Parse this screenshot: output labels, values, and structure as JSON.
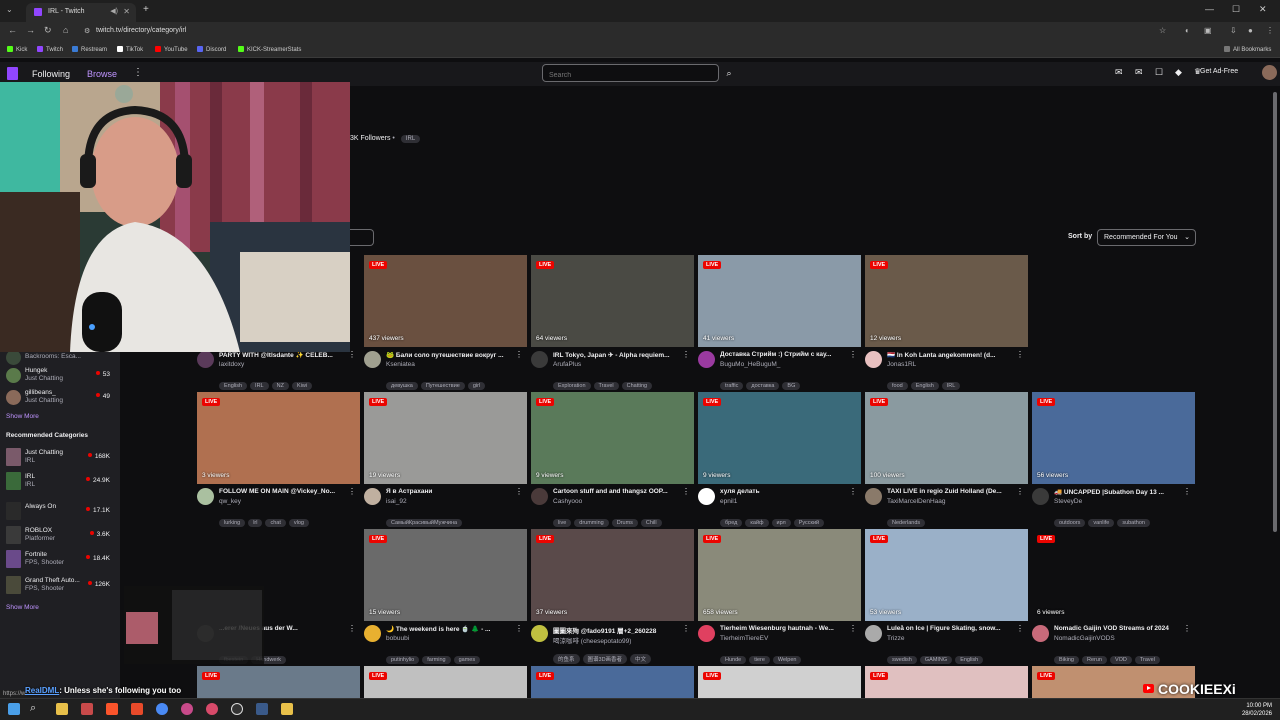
{
  "browser": {
    "tab_title": "IRL - Twitch",
    "url": "twitch.tv/directory/category/irl",
    "bookmarks": [
      "Kick",
      "Twitch",
      "Restream",
      "TikTok",
      "YouTube",
      "Discord",
      "KICK-StreamerStats"
    ],
    "all_bookmarks": "All Bookmarks",
    "status_url": "https://w..."
  },
  "topnav": {
    "following": "Following",
    "browse": "Browse",
    "search_placeholder": "Search",
    "ad_free": "Get Ad-Free"
  },
  "category": {
    "followers": "3K Followers",
    "tag": "IRL"
  },
  "sort": {
    "label": "Sort by",
    "value": "Recommended For You"
  },
  "sidebar": {
    "following": [
      {
        "name": "Backrooms: Esca...",
        "category": "",
        "viewers": ""
      },
      {
        "name": "Hungek",
        "category": "Just Chatting",
        "viewers": "53"
      },
      {
        "name": "gillibeans_",
        "category": "Just Chatting",
        "viewers": "49"
      }
    ],
    "show_more_1": "Show More",
    "recommended_heading": "Recommended Categories",
    "categories": [
      {
        "name": "Just Chatting",
        "sub": "IRL",
        "viewers": "168K"
      },
      {
        "name": "IRL",
        "sub": "IRL",
        "viewers": "24.9K"
      },
      {
        "name": "Always On",
        "sub": "",
        "viewers": "17.1K"
      },
      {
        "name": "ROBLOX",
        "sub": "Platformer",
        "viewers": "3.6K"
      },
      {
        "name": "Fortnite",
        "sub": "FPS, Shooter",
        "viewers": "18.4K"
      },
      {
        "name": "Grand Theft Auto...",
        "sub": "FPS, Shooter",
        "viewers": "126K"
      }
    ],
    "show_more_2": "Show More"
  },
  "streams": [
    {
      "title": "PARTY WITH @ltlsdante ✨ CELEB...",
      "channel": "laxitdoxy",
      "viewers": "",
      "tags": [
        "English",
        "IRL",
        "NZ",
        "Kiwi"
      ]
    },
    {
      "title": "🐸 Бали соло путешествие вокруг ...",
      "channel": "Kseniatea",
      "viewers": "437 viewers",
      "tags": [
        "девушка",
        "Путешествие",
        "girl"
      ]
    },
    {
      "title": "IRL Tokyo, Japan ✈ - Alpha requiem...",
      "channel": "ArufaPlus",
      "viewers": "64 viewers",
      "tags": [
        "Exploration",
        "Travel",
        "Chatting"
      ]
    },
    {
      "title": "Доставка Стрийм :) Стрийм с кау...",
      "channel": "BuguMo_HeBuguM_",
      "viewers": "41 viewers",
      "tags": [
        "traffic",
        "доставка",
        "BG"
      ]
    },
    {
      "title": "🇳🇱 In Koh Lanta angekommen! (d...",
      "channel": "Jonas1RL",
      "viewers": "12 viewers",
      "tags": [
        "food",
        "English",
        "IRL"
      ]
    },
    {
      "title": "FOLLOW ME ON MAIN @Vickey_No...",
      "channel": "qw_key",
      "viewers": "3 viewers",
      "tags": [
        "lurking",
        "lrl",
        "chat",
        "vlog"
      ]
    },
    {
      "title": "Я в Астрахани",
      "channel": "isai_92",
      "viewers": "19 viewers",
      "tags": [
        "СамыйКрасивыйМужчина"
      ]
    },
    {
      "title": "Cartoon stuff and and thangsz OOP...",
      "channel": "Cashyooo",
      "viewers": "9 viewers",
      "tags": [
        "live",
        "drumming",
        "Drums",
        "Chill"
      ]
    },
    {
      "title": "хуля делать",
      "channel": "epnil1",
      "viewers": "9 viewers",
      "tags": [
        "бред",
        "кайф",
        "ирл",
        "Русский"
      ]
    },
    {
      "title": "TAXI LIVE in regio Zuid Holland (De...",
      "channel": "TaxiMarcelDenHaag",
      "viewers": "100 viewers",
      "tags": [
        "Nederlands"
      ]
    },
    {
      "title": "🚚 UNCAPPED |Subathon Day 13 ...",
      "channel": "SteveyDe",
      "viewers": "56 viewers",
      "tags": [
        "outdoors",
        "vanlife",
        "subathon"
      ]
    },
    {
      "title": "...erer /Neues aus der W...",
      "channel": "",
      "viewers": "",
      "tags": [
        "fbestein",
        "Handwerk"
      ]
    },
    {
      "title": "🌙 The weekend is here 🍵 🌲 - ...",
      "channel": "bobuubi",
      "viewers": "15 viewers",
      "tags": [
        "putinhylio",
        "farming",
        "games"
      ]
    },
    {
      "title": "圖圖來殉 @fado9191 層+2_260228",
      "channel": "喝涼咖啡 (cheesepotato99)",
      "viewers": "37 viewers",
      "tags": [
        "的鱼系",
        "圖谱3D画香者",
        "中文"
      ]
    },
    {
      "title": "Tierheim Wiesenburg hautnah - We...",
      "channel": "TierheimTiereEV",
      "viewers": "658 viewers",
      "tags": [
        "Hunde",
        "tiere",
        "Welpen"
      ]
    },
    {
      "title": "Luleå on Ice | Figure Skating, snow...",
      "channel": "Trizze",
      "viewers": "53 viewers",
      "tags": [
        "swedish",
        "GAMING",
        "English"
      ]
    },
    {
      "title": "Nomadic Gaijin VOD Streams of 2024",
      "channel": "NomadicGaijinVODS",
      "viewers": "6 viewers",
      "tags": [
        "Biking",
        "Rerun",
        "VOD",
        "Travel"
      ]
    }
  ],
  "live_label": "LIVE",
  "chat": {
    "user": "RealDML",
    "message": ": Unless she's following you too"
  },
  "overlay_name": "COOKIEEXi",
  "clock": {
    "time": "10:00 PM",
    "date": "28/02/2026"
  }
}
